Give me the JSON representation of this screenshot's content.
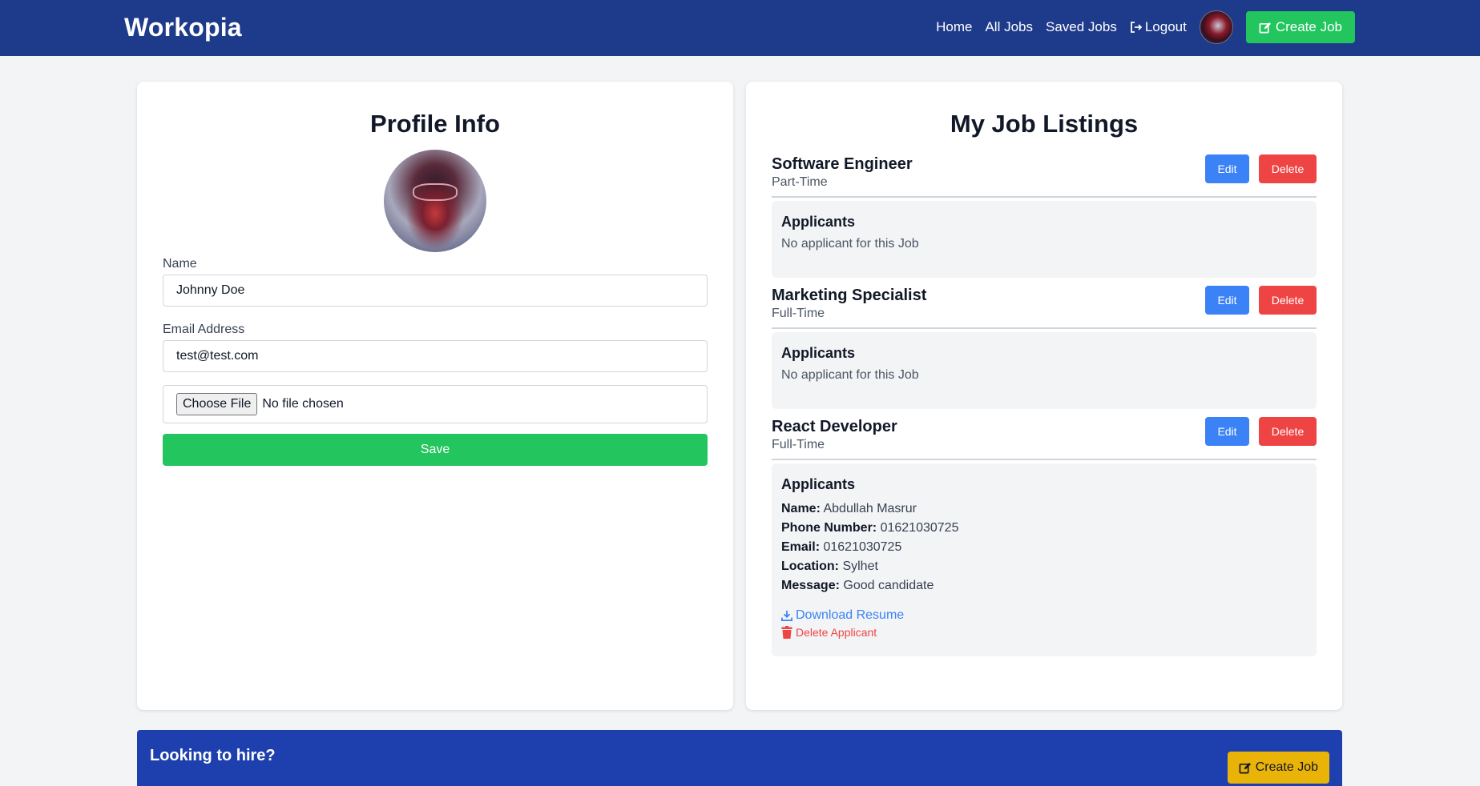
{
  "nav": {
    "brand": "Workopia",
    "links": [
      "Home",
      "All Jobs",
      "Saved Jobs"
    ],
    "logout": "Logout",
    "create_job": "Create Job"
  },
  "profile": {
    "title": "Profile Info",
    "name_label": "Name",
    "name_value": "Johnny Doe",
    "email_label": "Email Address",
    "email_value": "test@test.com",
    "file_button": "Choose File",
    "file_status": "No file chosen",
    "save": "Save"
  },
  "listings": {
    "title": "My Job Listings",
    "edit": "Edit",
    "delete": "Delete",
    "applicants_title": "Applicants",
    "jobs": [
      {
        "title": "Software Engineer",
        "type": "Part-Time",
        "empty": "No applicant for this Job"
      },
      {
        "title": "Marketing Specialist",
        "type": "Full-Time",
        "empty": "No applicant for this Job"
      },
      {
        "title": "React Developer",
        "type": "Full-Time"
      }
    ],
    "applicant": {
      "name_label": "Name:",
      "name": "Abdullah Masrur",
      "phone_label": "Phone Number:",
      "phone": "01621030725",
      "email_label": "Email:",
      "email": "01621030725",
      "location_label": "Location:",
      "location": "Sylhet",
      "message_label": "Message:",
      "message": "Good candidate",
      "download": "Download Resume",
      "delete": "Delete Applicant"
    }
  },
  "banner": {
    "text": "Looking to hire?",
    "button": "Create Job"
  },
  "colors": {
    "nav": "#1e3a8a",
    "green": "#22c55e",
    "blue": "#3b82f6",
    "red": "#ef4444",
    "yellow": "#eab308"
  }
}
